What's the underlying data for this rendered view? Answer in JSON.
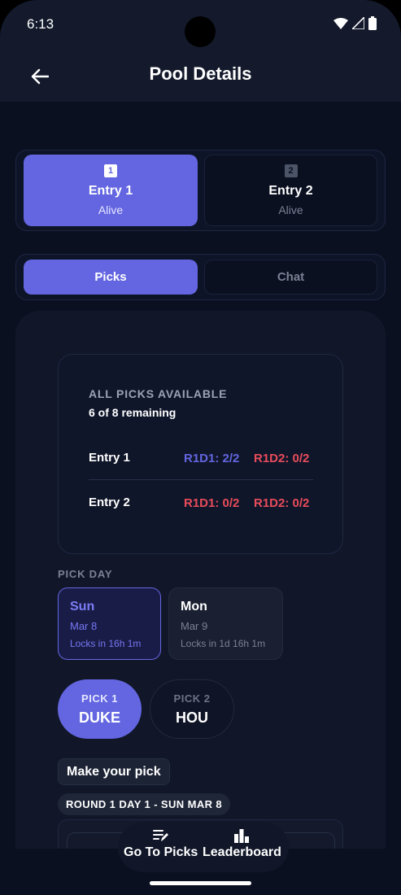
{
  "status_bar": {
    "time": "6:13"
  },
  "app_bar": {
    "title": "Pool Details"
  },
  "entries": [
    {
      "badge": "1",
      "name": "Entry 1",
      "status": "Alive",
      "selected": true
    },
    {
      "badge": "2",
      "name": "Entry 2",
      "status": "Alive",
      "selected": false
    }
  ],
  "tabs": [
    {
      "label": "Picks",
      "selected": true
    },
    {
      "label": "Chat",
      "selected": false
    }
  ],
  "summary": {
    "title": "ALL PICKS AVAILABLE",
    "subtitle": "6 of 8 remaining",
    "rows": [
      {
        "entry": "Entry 1",
        "r1": "R1D1: 2/2",
        "r2": "R1D2: 0/2",
        "r1_color": "#6366e0",
        "r2_color": "#e84c5a"
      },
      {
        "entry": "Entry 2",
        "r1": "R1D1: 0/2",
        "r2": "R1D2: 0/2",
        "r1_color": "#e84c5a",
        "r2_color": "#e84c5a"
      }
    ]
  },
  "pick_day": {
    "label": "PICK DAY",
    "days": [
      {
        "day": "Sun",
        "date": "Mar 8",
        "locks": "Locks in 16h 1m",
        "selected": true
      },
      {
        "day": "Mon",
        "date": "Mar 9",
        "locks": "Locks in 1d 16h 1m",
        "selected": false
      }
    ]
  },
  "picks": [
    {
      "label": "PICK 1",
      "team": "DUKE",
      "selected": true
    },
    {
      "label": "PICK 2",
      "team": "HOU",
      "selected": false
    }
  ],
  "make_pick_label": "Make your pick",
  "round_label": "ROUND 1 DAY 1 - SUN MAR 8",
  "bottom_nav": {
    "go_to_picks": "Go To Picks",
    "leaderboard": "Leaderboard"
  },
  "colors": {
    "accent": "#6366e0",
    "danger": "#e84c5a",
    "background": "#0b1021"
  }
}
